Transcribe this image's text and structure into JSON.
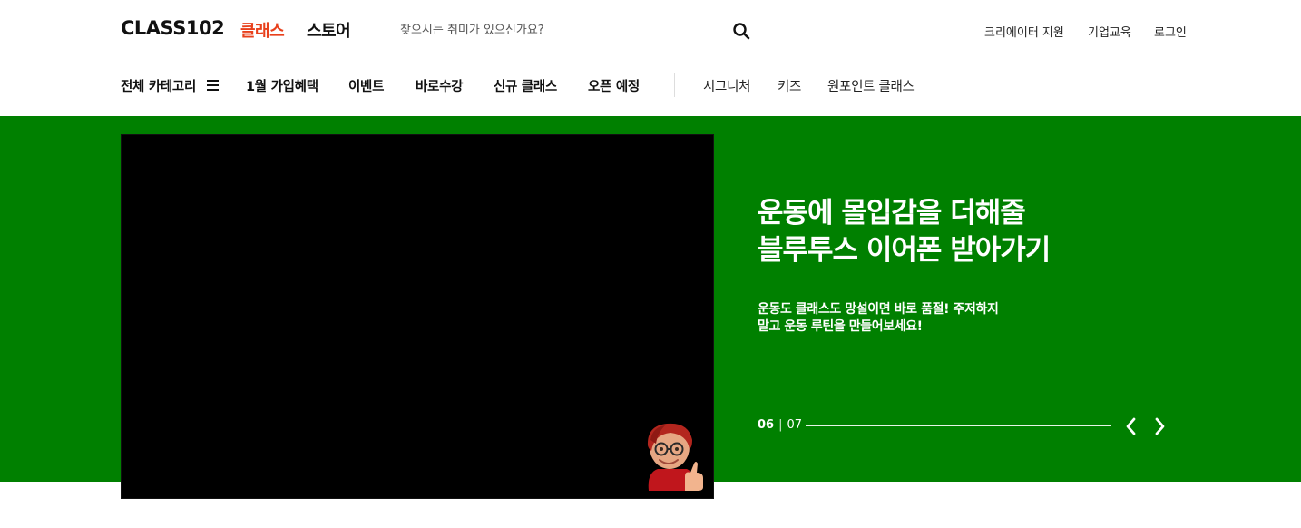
{
  "header": {
    "logo": "CLASS102",
    "tabs": [
      {
        "label": "클래스",
        "active": true
      },
      {
        "label": "스토어",
        "active": false
      }
    ],
    "search": {
      "placeholder": "찾으시는 취미가 있으신가요?",
      "value": "",
      "icon": "search-icon"
    },
    "utility_links": [
      "크리에이터 지원",
      "기업교육",
      "로그인"
    ]
  },
  "nav": {
    "all_categories": "전체 카테고리",
    "menu_icon": "hamburger-menu-icon",
    "primary_items": [
      "1월 가입혜택",
      "이벤트",
      "바로수강",
      "신규 클래스",
      "오픈 예정"
    ],
    "secondary_items": [
      "시그니처",
      "키즈",
      "원포인트 클래스"
    ]
  },
  "banner": {
    "background_color": "#008000",
    "headline": [
      "운동에 몰입감을 더해줄",
      "블루투스 이어폰 받아가기"
    ],
    "subtext": [
      "운동도 클래스도 망설이면 바로 품절! 주저하지",
      "말고 운동 루틴을 만들어보세요!"
    ],
    "slide_current": "06",
    "slide_separator": "|",
    "slide_total": "07",
    "prev_icon": "chevron-left-icon",
    "next_icon": "chevron-right-icon"
  },
  "colors": {
    "accent": "#e8401c",
    "banner_green": "#008000"
  }
}
